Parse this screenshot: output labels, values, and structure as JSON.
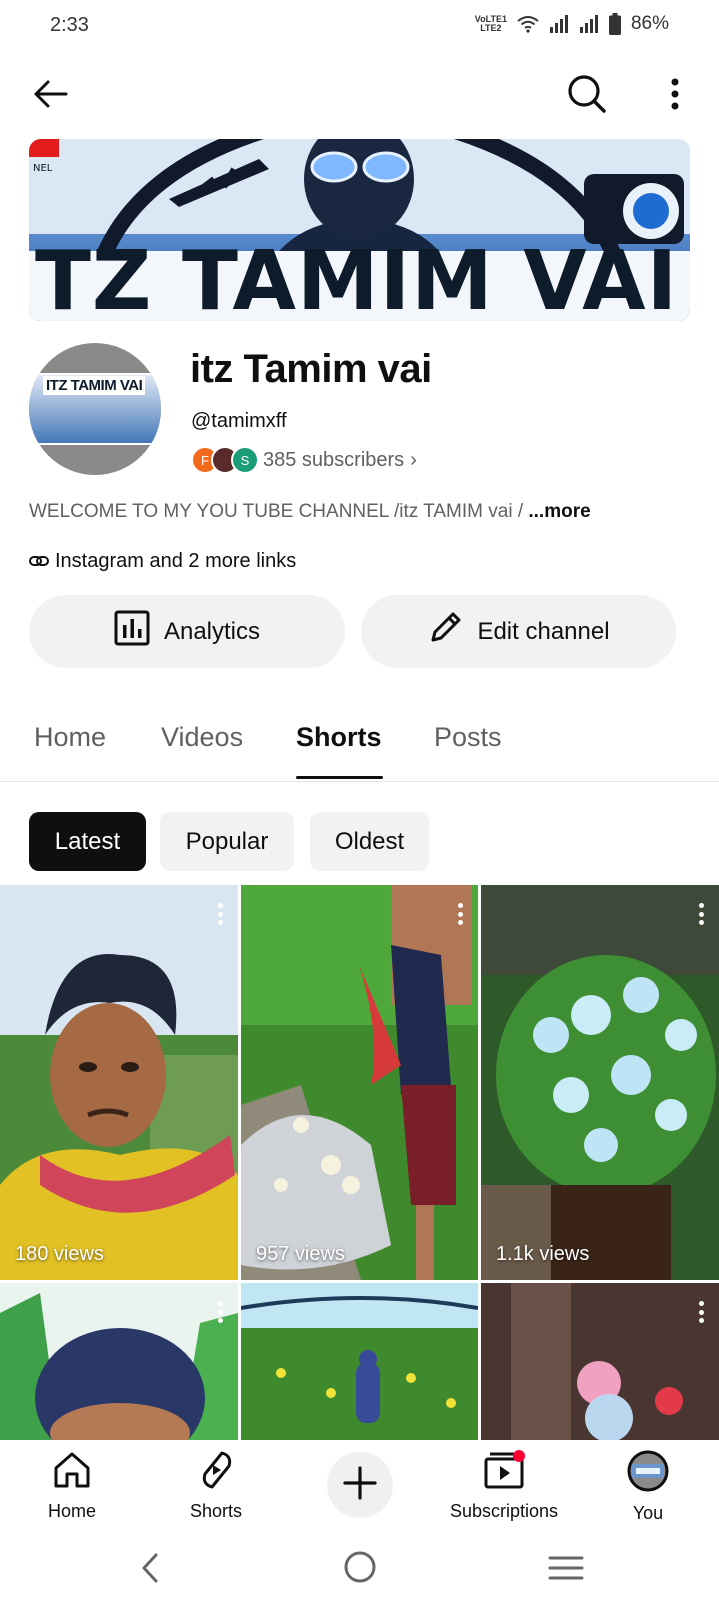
{
  "status_bar": {
    "time": "2:33",
    "network_label_top": "VoLTE1",
    "network_label_bottom": "LTE2",
    "battery": "86%",
    "icons": [
      "volte-icon",
      "wifi-icon",
      "signal-icon",
      "signal-icon",
      "battery-icon"
    ]
  },
  "topbar": {
    "icons": [
      "back-arrow-icon",
      "search-icon",
      "more-vert-icon"
    ]
  },
  "banner": {
    "text": "TZ TAMIM VAI"
  },
  "avatar": {
    "text": "ITZ TAMIM VAI"
  },
  "channel": {
    "name": "itz Tamim vai",
    "handle": "@tamimxff",
    "subscribers": "385 subscribers",
    "subscriber_avatars": [
      {
        "letter": "F",
        "color": "#f26b1d"
      },
      {
        "letter": "",
        "color": "#5a2a2a"
      },
      {
        "letter": "S",
        "color": "#1b9e77"
      }
    ],
    "description": "WELCOME TO  MY  YOU TUBE CHANNEL /itz TAMIM vai / ",
    "description_more": "...more",
    "links": "Instagram and 2 more links"
  },
  "actions": {
    "analytics": "Analytics",
    "edit_channel": "Edit channel"
  },
  "tabs": [
    "Home",
    "Videos",
    "Shorts",
    "Posts"
  ],
  "active_tab": "Shorts",
  "chips": [
    "Latest",
    "Popular",
    "Oldest"
  ],
  "active_chip": "Latest",
  "shorts": [
    {
      "views": "180 views"
    },
    {
      "views": "957 views"
    },
    {
      "views": "1.1k views"
    },
    {
      "views": ""
    },
    {
      "views": ""
    },
    {
      "views": ""
    }
  ],
  "bottom_nav": {
    "home": "Home",
    "shorts": "Shorts",
    "subscriptions": "Subscriptions",
    "you": "You"
  },
  "colors": {
    "accent": "#0f0f0f",
    "secondary_text": "#606060",
    "chip_bg": "#f2f2f2",
    "notification_dot": "#ff0033"
  }
}
